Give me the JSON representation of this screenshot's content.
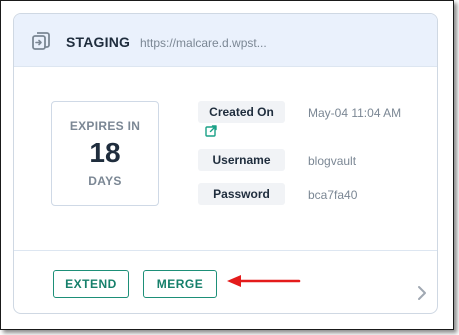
{
  "card": {
    "title": "STAGING",
    "url": "https://malcare.d.wpst...",
    "icon": "staging-copy-icon"
  },
  "expiry": {
    "label": "EXPIRES IN",
    "value": "18",
    "unit": "DAYS"
  },
  "details": [
    {
      "key": "Created On",
      "value": "May-04 11:04 AM"
    },
    {
      "key": "Username",
      "value": "blogvault"
    },
    {
      "key": "Password",
      "value": "bca7fa40"
    }
  ],
  "icons": {
    "external_link": "external-link-icon",
    "chevron": "chevron-right-icon",
    "annotation": "red-arrow-icon"
  },
  "actions": {
    "extend_label": "EXTEND",
    "merge_label": "MERGE"
  },
  "colors": {
    "header_bg": "#eaf1fc",
    "accent": "#16806b",
    "link": "#1aa187",
    "annotation": "#e41b1b"
  }
}
